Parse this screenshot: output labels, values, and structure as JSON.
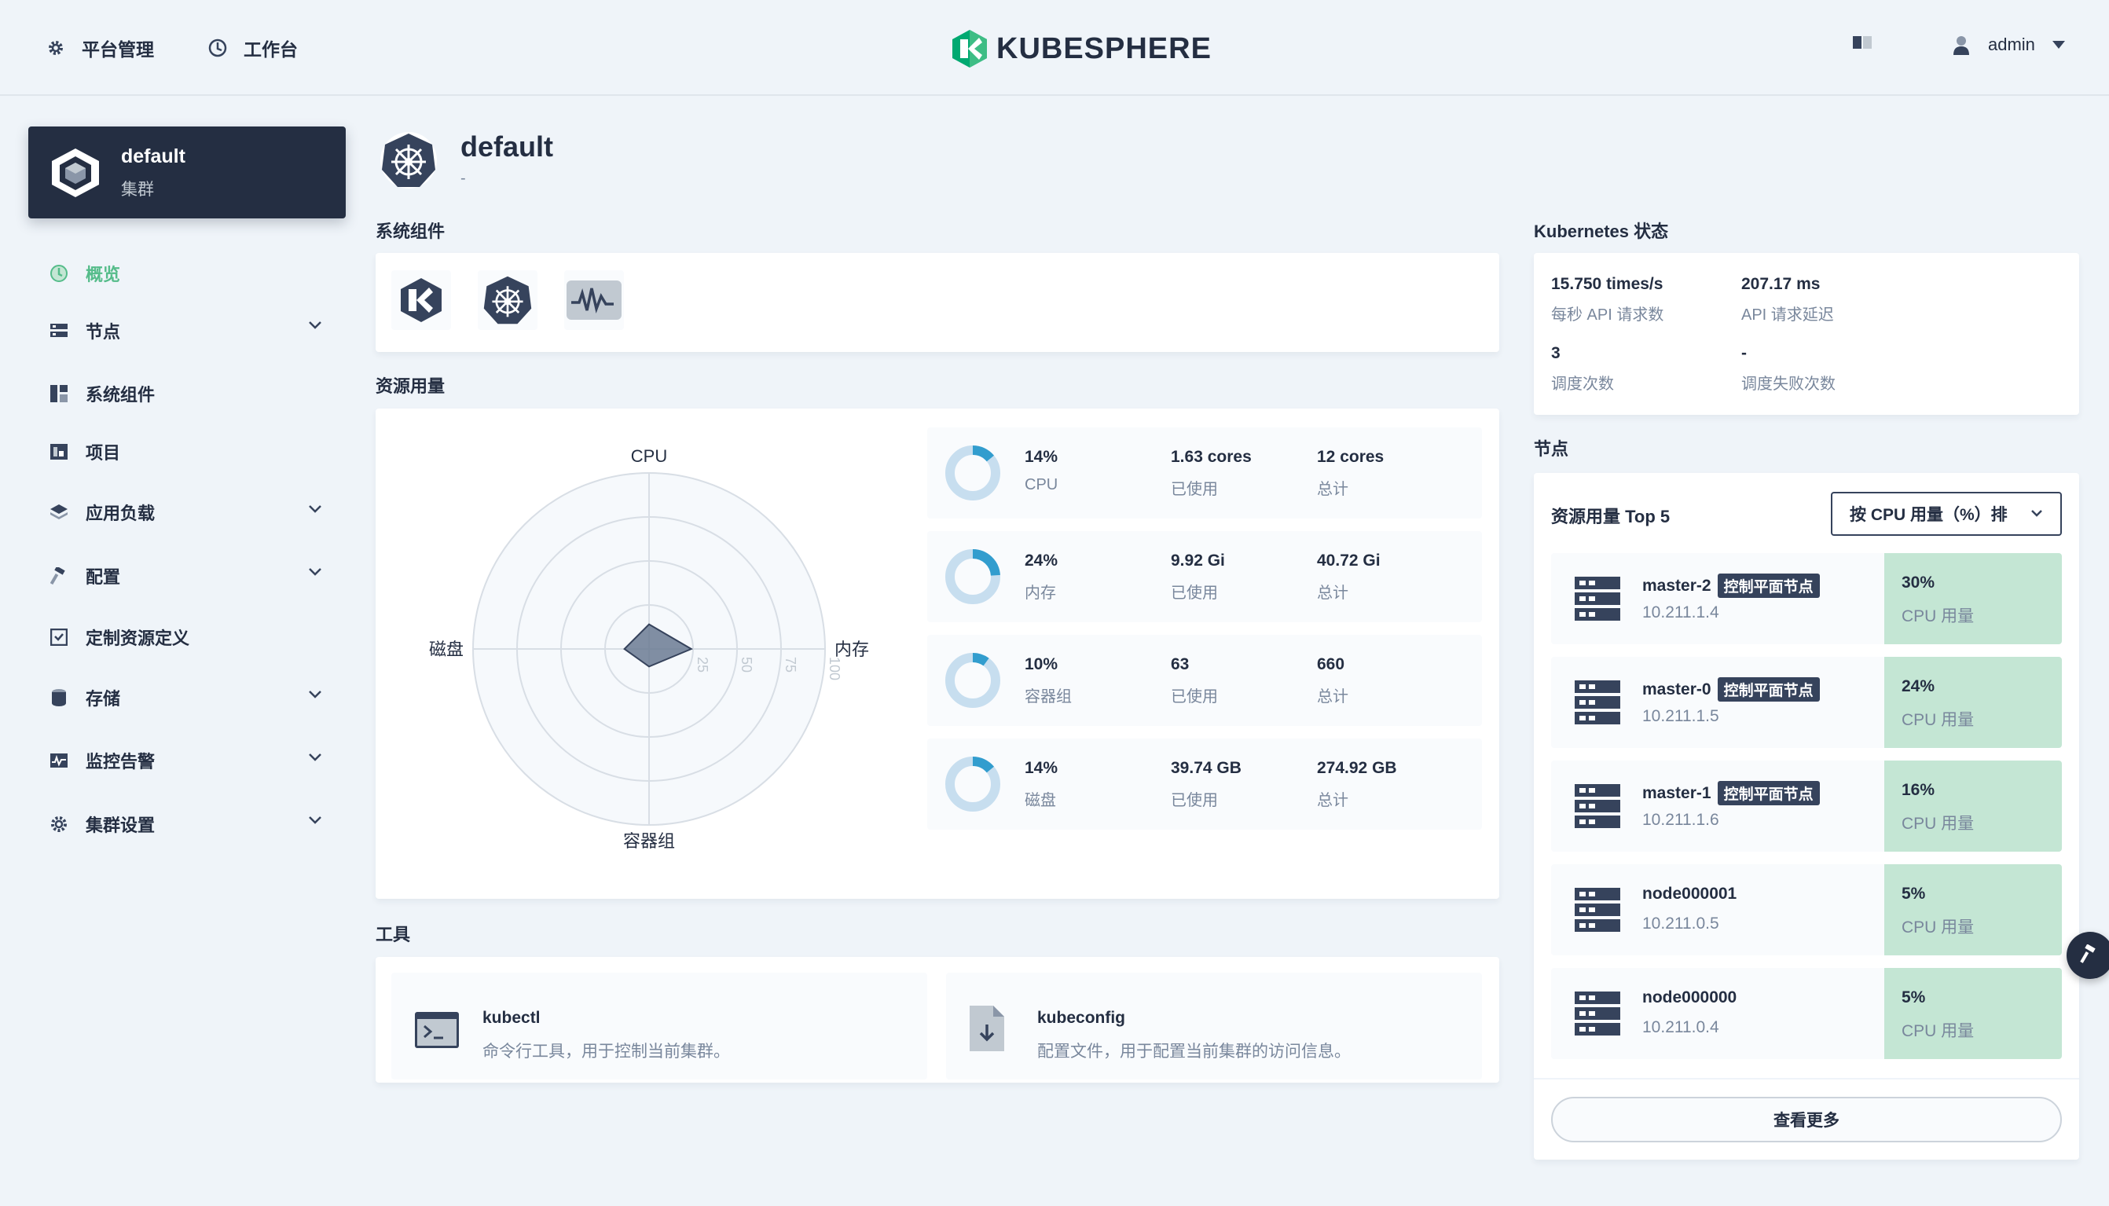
{
  "topbar": {
    "platform_label": "平台管理",
    "workbench_label": "工作台",
    "logo_text": "KUBESPHERE",
    "user_name": "admin"
  },
  "cluster": {
    "name": "default",
    "type_label": "集群"
  },
  "sidebar": {
    "items": [
      {
        "label": "概览",
        "icon": "dashboard-icon",
        "expandable": false,
        "active": true
      },
      {
        "label": "节点",
        "icon": "nodes-icon",
        "expandable": true
      },
      {
        "label": "系统组件",
        "icon": "components-icon",
        "expandable": false
      },
      {
        "label": "项目",
        "icon": "project-icon",
        "expandable": false
      },
      {
        "label": "应用负载",
        "icon": "appstore-icon",
        "expandable": true
      },
      {
        "label": "配置",
        "icon": "hammer-icon",
        "expandable": true
      },
      {
        "label": "定制资源定义",
        "icon": "crd-icon",
        "expandable": false
      },
      {
        "label": "存储",
        "icon": "storage-icon",
        "expandable": true
      },
      {
        "label": "监控告警",
        "icon": "monitor-icon",
        "expandable": true
      },
      {
        "label": "集群设置",
        "icon": "cluster-settings-icon",
        "expandable": true
      }
    ]
  },
  "header": {
    "title": "default",
    "description": "-"
  },
  "sections": {
    "components": "系统组件",
    "resources": "资源用量",
    "tools": "工具",
    "k8s": "Kubernetes 状态",
    "nodes": "节点"
  },
  "radar": {
    "axes": {
      "top": "CPU",
      "right": "内存",
      "bottom": "容器组",
      "left": "磁盘"
    },
    "ticks": [
      "25",
      "50",
      "75",
      "100"
    ],
    "values": {
      "cpu": 14,
      "memory": 24,
      "pods": 10,
      "disk": 14
    }
  },
  "resources": [
    {
      "percent": 14,
      "percent_label": "14%",
      "name": "CPU",
      "used": "1.63 cores",
      "used_label": "已使用",
      "total": "12 cores",
      "total_label": "总计"
    },
    {
      "percent": 24,
      "percent_label": "24%",
      "name": "内存",
      "used": "9.92 Gi",
      "used_label": "已使用",
      "total": "40.72 Gi",
      "total_label": "总计"
    },
    {
      "percent": 10,
      "percent_label": "10%",
      "name": "容器组",
      "used": "63",
      "used_label": "已使用",
      "total": "660",
      "total_label": "总计"
    },
    {
      "percent": 14,
      "percent_label": "14%",
      "name": "磁盘",
      "used": "39.74 GB",
      "used_label": "已使用",
      "total": "274.92 GB",
      "total_label": "总计"
    }
  ],
  "tools": [
    {
      "name": "kubectl",
      "desc": "命令行工具，用于控制当前集群。"
    },
    {
      "name": "kubeconfig",
      "desc": "配置文件，用于配置当前集群的访问信息。"
    }
  ],
  "k8s_status": [
    {
      "value": "15.750 times/s",
      "label": "每秒 API 请求数"
    },
    {
      "value": "207.17 ms",
      "label": "API 请求延迟"
    },
    {
      "value": "3",
      "label": "调度次数"
    },
    {
      "value": "-",
      "label": "调度失败次数"
    }
  ],
  "nodes_panel": {
    "title": "资源用量 Top 5",
    "sort_select": "按 CPU 用量（%）排",
    "more_label": "查看更多",
    "rows": [
      {
        "name": "master-2",
        "badge": "控制平面节点",
        "ip": "10.211.1.4",
        "usage": "30%",
        "usage_label": "CPU 用量"
      },
      {
        "name": "master-0",
        "badge": "控制平面节点",
        "ip": "10.211.1.5",
        "usage": "24%",
        "usage_label": "CPU 用量"
      },
      {
        "name": "master-1",
        "badge": "控制平面节点",
        "ip": "10.211.1.6",
        "usage": "16%",
        "usage_label": "CPU 用量"
      },
      {
        "name": "node000001",
        "badge": "",
        "ip": "10.211.0.5",
        "usage": "5%",
        "usage_label": "CPU 用量"
      },
      {
        "name": "node000000",
        "badge": "",
        "ip": "10.211.0.4",
        "usage": "5%",
        "usage_label": "CPU 用量"
      }
    ]
  },
  "colors": {
    "accent": "#55bc8a",
    "dark": "#242e42",
    "donut": "#329dce",
    "donut_track": "#c7deef",
    "usage_bg": "#c4e6d4"
  }
}
